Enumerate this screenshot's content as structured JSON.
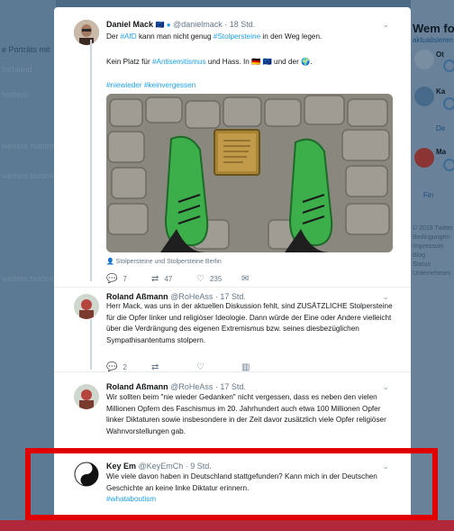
{
  "background": {
    "left_fragments": [
      "e Porträts mit",
      "tschland",
      "twittern",
      "weitere twittern",
      "weitere twittern",
      "weitere twittern"
    ],
    "right_title": "Wem fol",
    "right_link": "aktualisieren",
    "right_items": [
      "Ot",
      "Ka",
      "De",
      "Ma",
      "Fin"
    ],
    "footer": [
      "© 2018 Twitter",
      "Bedingungen",
      "Impressum",
      "Blog",
      "Status",
      "Unternehmen"
    ]
  },
  "tweets": [
    {
      "name": "Daniel Mack",
      "handle": "@danielmack · 18 Std.",
      "text_prefix": "Der ",
      "hashtag1": "#AfD",
      "text_mid": " kann man nicht genug ",
      "hashtag2": "#Stolpersteine",
      "text_suffix": " in den Weg legen.",
      "line2_prefix": "Kein Platz für ",
      "line2_hashtag": "#Antisemitismus",
      "line2_suffix": " und Hass. In 🇩🇪 🇪🇺 und der 🌍.",
      "hashtags_line": "#niewieder #keinvergessen",
      "caption": "Stolpersteine und Stolpersteine Berlin",
      "replies": "7",
      "retweets": "47",
      "likes": "235"
    },
    {
      "name": "Roland Aßmann",
      "handle": "@RoHeAss · 17 Std.",
      "text": "Herr Mack, was uns in der aktuellen Diskussion fehlt, sind ZUSÄTZLICHE Stolpersteine für die Opfer linker und religiöser Ideologie. Dann würde der Eine oder Andere vielleicht über die Verdrängung des eigenen Extremismus bzw. seines diesbezüglichen Sympathisantentums stolpern.",
      "replies": "2"
    },
    {
      "name": "Roland Aßmann",
      "handle": "@RoHeAss · 17 Std.",
      "text": "Wir sollten beim \"nie wieder Gedanken\" nicht vergessen, dass es neben den vielen Millionen Opfern des Faschismus im 20. Jahrhundert auch etwa 100 Millionen Opfer linker Diktaturen sowie insbesondere in der Zeit davor zusätzlich viele Opfer religiöser Wahnvorstellungen gab."
    },
    {
      "name": "Key Em",
      "handle": "@KeyEmCh · 9 Std.",
      "text": "Wie viele davon haben in Deutschland stattgefunden? Kann mich in der Deutschen Geschichte an keine linke Diktatur erinnern.",
      "hashtag": "#whataboutism"
    }
  ],
  "colors": {
    "highlight": "#e00000",
    "link": "#1da1f2"
  }
}
